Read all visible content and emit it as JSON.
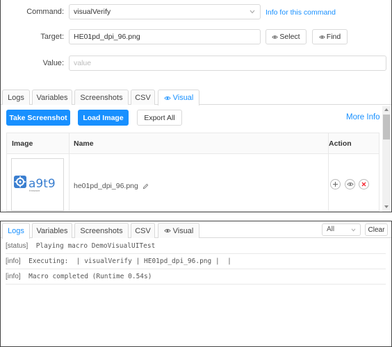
{
  "editor": {
    "command": {
      "label": "Command",
      "value": "visualVerify",
      "info_link": "Info for this command"
    },
    "target": {
      "label": "Target",
      "value": "HE01pd_dpi_96.png",
      "select_label": "Select",
      "find_label": "Find"
    },
    "value": {
      "label": "Value",
      "placeholder": "value"
    }
  },
  "top_tabs": [
    {
      "label": "Logs",
      "active": false
    },
    {
      "label": "Variables",
      "active": false
    },
    {
      "label": "Screenshots",
      "active": false
    },
    {
      "label": "CSV",
      "active": false
    },
    {
      "label": "Visual",
      "active": true,
      "icon": "eye-icon"
    }
  ],
  "visual": {
    "take_screenshot": "Take Screenshot",
    "load_image": "Load Image",
    "export_all": "Export All",
    "more_info": "More Info",
    "columns": [
      "Image",
      "Name",
      "Action"
    ],
    "rows": [
      {
        "thumbnail_text": "a9t9",
        "thumbnail_sub": "freeware",
        "name": "he01pd_dpi_96.png"
      }
    ]
  },
  "bottom_tabs": [
    {
      "label": "Logs",
      "active": true
    },
    {
      "label": "Variables",
      "active": false
    },
    {
      "label": "Screenshots",
      "active": false
    },
    {
      "label": "CSV",
      "active": false
    },
    {
      "label": "Visual",
      "active": false,
      "icon": "eye-icon"
    }
  ],
  "log_filter": "All",
  "clear_label": "Clear",
  "logs": [
    {
      "type": "[status]",
      "text": "Playing macro DemoVisualUITest"
    },
    {
      "type": "[info]",
      "text": "Executing:  | visualVerify | HE01pd_dpi_96.png |  |"
    },
    {
      "type": "[info]",
      "text": "Macro completed (Runtime 0.54s)"
    }
  ],
  "colors": {
    "accent": "#1890ff",
    "border": "#d9d9d9",
    "danger": "#f5222d",
    "logo": "#3b7fd0"
  }
}
